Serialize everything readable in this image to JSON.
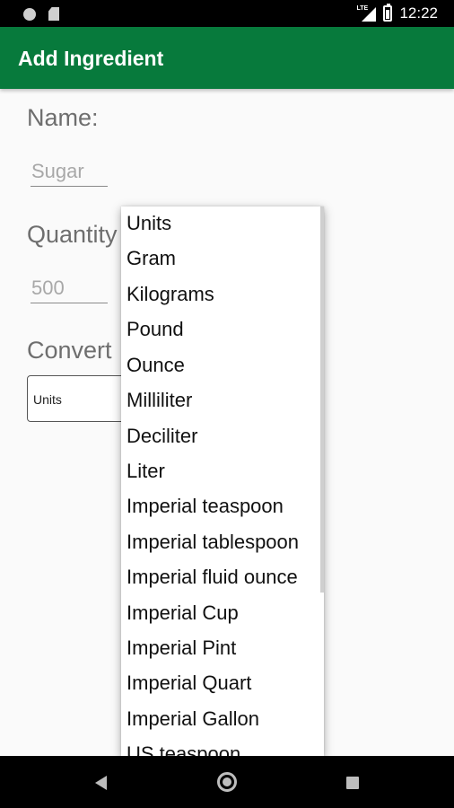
{
  "status_bar": {
    "time": "12:22",
    "network": "LTE"
  },
  "app_bar": {
    "title": "Add Ingredient"
  },
  "form": {
    "name_label": "Name:",
    "name_value": "Sugar",
    "quantity_label": "Quantity",
    "quantity_value": "500",
    "convert_label": "Convert",
    "units_selected": "Units"
  },
  "dropdown": {
    "items": [
      "Units",
      "Gram",
      "Kilograms",
      "Pound",
      "Ounce",
      "Milliliter",
      "Deciliter",
      "Liter",
      "Imperial teaspoon",
      "Imperial tablespoon",
      "Imperial fluid ounce",
      "Imperial Cup",
      "Imperial Pint",
      "Imperial Quart",
      "Imperial Gallon",
      "US teaspoon"
    ]
  },
  "colors": {
    "app_bar": "#077a3c",
    "background": "#fafafa"
  },
  "nav_bar": {
    "icons": [
      "back-icon",
      "home-icon",
      "recents-icon"
    ]
  }
}
